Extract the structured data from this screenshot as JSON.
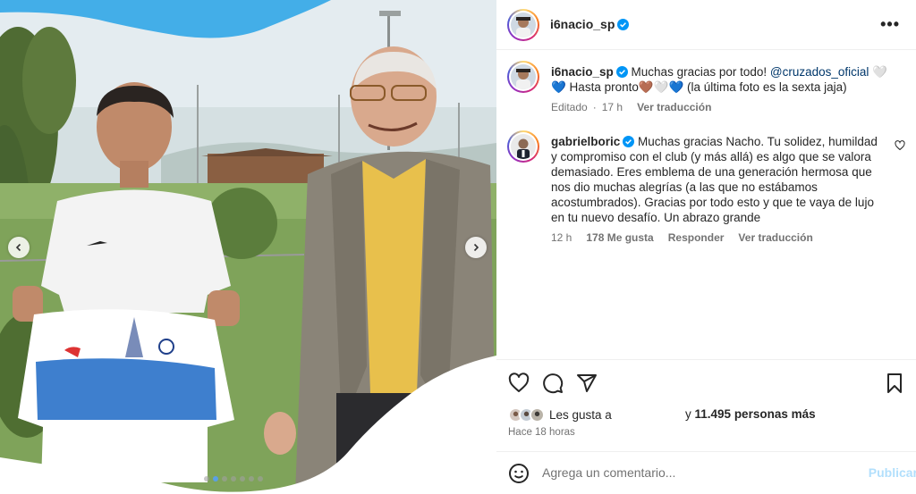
{
  "post": {
    "author": "i6nacio_sp",
    "more_label": "•••"
  },
  "caption": {
    "user": "i6nacio_sp",
    "text_before": "Muchas gracias por todo! ",
    "mention": "@cruzados_oficial",
    "text_after": " 🤍 💙 Hasta pronto🤎🤍💙 (la última foto es la sexta jaja)",
    "edited": "Editado",
    "time": "17 h",
    "see_translation": "Ver traducción"
  },
  "comment": {
    "user": "gabrielboric",
    "text": "Muchas gracias Nacho. Tu solidez, humildad y compromiso con el club (y más allá) es algo que se valora demasiado. Eres emblema de una generación hermosa que nos dio muchas alegrías (a las que no estábamos acostumbrados). Gracias por todo esto y que te vaya de lujo en tu nuevo desafío. Un abrazo grande",
    "time": "12 h",
    "likes": "178 Me gusta",
    "reply": "Responder",
    "see_translation": "Ver traducción"
  },
  "likes": {
    "prefix": "Les gusta a",
    "suffix_pre": "y ",
    "count": "11.495 personas más"
  },
  "timestamp": "Hace 18 horas",
  "composer": {
    "placeholder": "Agrega un comentario...",
    "publish": "Publicar"
  },
  "carousel": {
    "slides": 7,
    "active_slide": 2
  },
  "icons": {
    "verified": "verified-badge-icon",
    "heart": "heart-icon",
    "comment": "comment-icon",
    "share": "share-icon",
    "save": "bookmark-icon",
    "emoji": "emoji-icon",
    "prev": "chevron-left-icon",
    "next": "chevron-right-icon"
  },
  "colors": {
    "verified": "#0095f6",
    "mention": "#00376b",
    "publish_disabled": "#b2dffc"
  }
}
